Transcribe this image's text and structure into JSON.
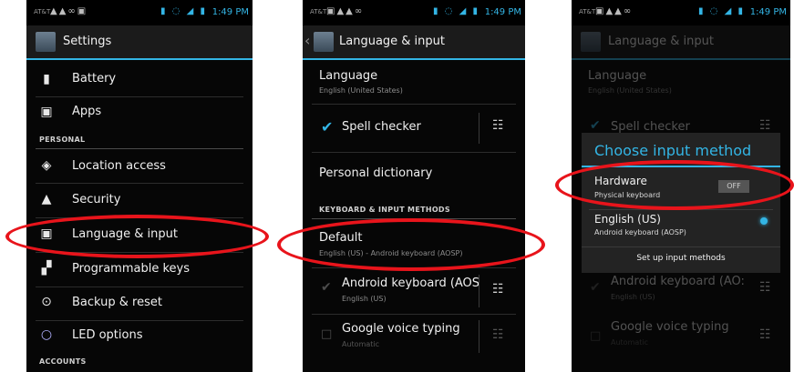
{
  "panel1": {
    "status": {
      "carrier": "AT&T",
      "time": "1:49 PM"
    },
    "title": "Settings",
    "items": [
      {
        "label": "Battery",
        "icon": "battery-icon"
      },
      {
        "label": "Apps",
        "icon": "apps-icon"
      },
      {
        "label": "Location access",
        "icon": "location-icon"
      },
      {
        "label": "Security",
        "icon": "lock-icon"
      },
      {
        "label": "Language & input",
        "icon": "language-icon"
      },
      {
        "label": "Programmable keys",
        "icon": "keys-icon"
      },
      {
        "label": "Backup & reset",
        "icon": "backup-icon"
      },
      {
        "label": "LED options",
        "icon": "led-icon"
      }
    ],
    "headers": {
      "personal": "PERSONAL",
      "accounts": "ACCOUNTS"
    }
  },
  "panel2": {
    "status": {
      "carrier": "AT&T",
      "time": "1:49 PM"
    },
    "title": "Language & input",
    "language": {
      "label": "Language",
      "sub": "English (United States)"
    },
    "spell_checker": {
      "label": "Spell checker"
    },
    "personal_dictionary": {
      "label": "Personal dictionary"
    },
    "header": "KEYBOARD & INPUT METHODS",
    "default": {
      "label": "Default",
      "sub": "English (US) - Android keyboard (AOSP)"
    },
    "android_keyboard": {
      "label": "Android keyboard (AOS",
      "sub": "English (US)"
    },
    "google_voice": {
      "label": "Google voice typing",
      "sub": "Automatic"
    }
  },
  "panel3": {
    "status": {
      "carrier": "AT&T",
      "time": "1:49 PM"
    },
    "title": "Language & input",
    "bg": {
      "language": "Language",
      "language_sub": "English (United States)",
      "spell": "Spell checker",
      "android_keyboard": "Android keyboard (AO:",
      "android_sub": "English (US)",
      "google_voice": "Google voice typing",
      "google_sub": "Automatic"
    },
    "dialog": {
      "title": "Choose input method",
      "hardware": {
        "label": "Hardware",
        "sub": "Physical keyboard",
        "toggle": "OFF"
      },
      "english": {
        "label": "English (US)",
        "sub": "Android keyboard (AOSP)"
      },
      "setup": "Set up input methods"
    }
  },
  "colors": {
    "accent": "#33b5e5",
    "highlight_ring": "#e8141b",
    "background": "#060606"
  }
}
